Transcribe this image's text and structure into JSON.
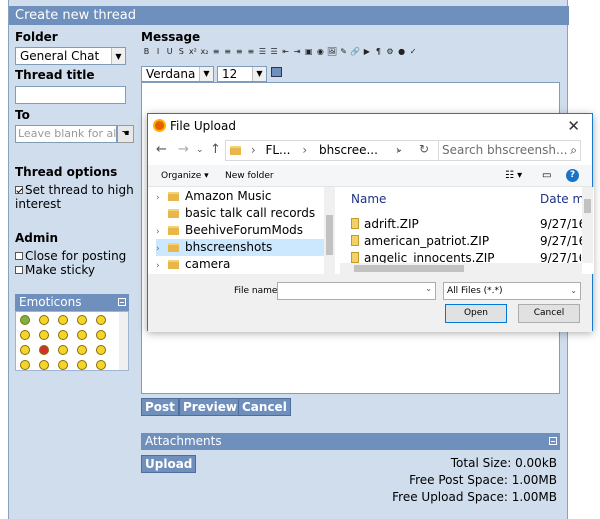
{
  "page": {
    "title": "Create new thread"
  },
  "folder": {
    "label": "Folder",
    "value": "General Chat"
  },
  "thread_title": {
    "label": "Thread title",
    "value": ""
  },
  "to": {
    "label": "To",
    "placeholder": "Leave blank for all"
  },
  "thread_options": {
    "label": "Thread options",
    "interest": "Set thread to high interest"
  },
  "admin": {
    "label": "Admin",
    "close": "Close for posting",
    "sticky": "Make sticky"
  },
  "emoticons": {
    "title": "Emoticons"
  },
  "message": {
    "label": "Message",
    "toolbar": [
      "B",
      "I",
      "U",
      "S",
      "x²",
      "x₂",
      "≡",
      "≡",
      "≡",
      "≡",
      "☰",
      "☰",
      "⇤",
      "⇥",
      "▣",
      "◉",
      "🖼",
      "✎",
      "🔗",
      "▶",
      "¶",
      "⚙",
      "●",
      "✓"
    ],
    "font": "Verdana",
    "size": "12"
  },
  "actions": {
    "post": "Post",
    "preview": "Preview",
    "cancel": "Cancel"
  },
  "attachments": {
    "title": "Attachments",
    "upload": "Upload",
    "total_size": "Total Size: 0.00kB",
    "free_post": "Free Post Space: 1.00MB",
    "free_upload": "Free Upload Space: 1.00MB"
  },
  "dialog": {
    "title": "File Upload",
    "breadcrumb": [
      "FL...",
      "bhscree..."
    ],
    "search_placeholder": "Search bhscreensh...",
    "organize": "Organize ▾",
    "new_folder": "New folder",
    "nav_items": [
      "Amazon Music",
      "basic talk call records",
      "BeehiveForumMods",
      "bhscreenshots",
      "camera"
    ],
    "col_name": "Name",
    "col_date": "Date m",
    "files": [
      {
        "name": "adrift.ZIP",
        "date": "9/27/16"
      },
      {
        "name": "american_patriot.ZIP",
        "date": "9/27/16"
      },
      {
        "name": "angelic_innocents.ZIP",
        "date": "9/27/16"
      }
    ],
    "file_name_label": "File name:",
    "file_name_value": "",
    "filter": "All Files (*.*)",
    "open": "Open",
    "cancel": "Cancel"
  }
}
